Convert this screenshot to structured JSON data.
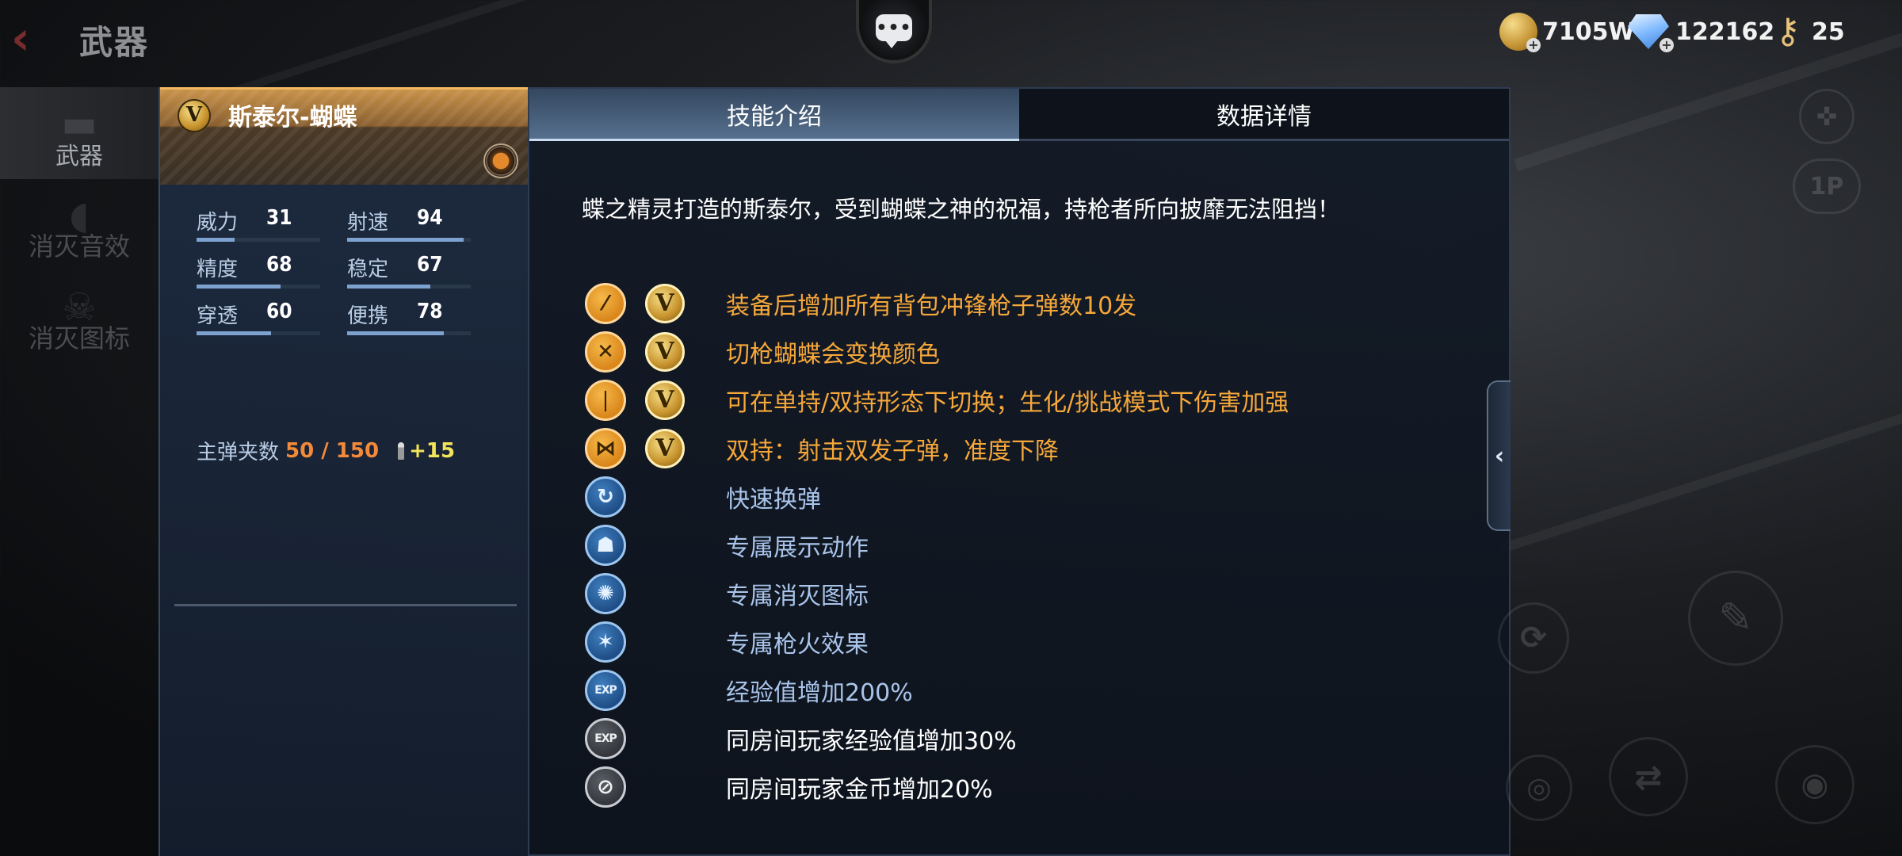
{
  "header": {
    "title": "武器",
    "back_icon": "back-arrow-icon",
    "chat_icon": "chat-icon"
  },
  "side_menu": [
    {
      "label": "武器",
      "icon": "rifle-icon",
      "active": true
    },
    {
      "label": "消灭音效",
      "icon": "speaker-icon",
      "active": false
    },
    {
      "label": "消灭图标",
      "icon": "skull-icon",
      "active": false
    }
  ],
  "currency": {
    "gold": "7105W",
    "diamond": "122162",
    "key": "25"
  },
  "weapon": {
    "badge": "V",
    "name": "斯泰尔-蝴蝶",
    "stats": [
      {
        "label": "威力",
        "value": "31",
        "level": 31
      },
      {
        "label": "射速",
        "value": "94",
        "level": 94
      },
      {
        "label": "精度",
        "value": "68",
        "level": 68
      },
      {
        "label": "稳定",
        "value": "67",
        "level": 67
      },
      {
        "label": "穿透",
        "value": "60",
        "level": 60
      },
      {
        "label": "便携",
        "value": "78",
        "level": 78
      }
    ],
    "ammo_label": "主弹夹数",
    "ammo_value": "50 / 150",
    "ammo_bonus": "+15"
  },
  "tabs": [
    {
      "label": "技能介绍",
      "active": true
    },
    {
      "label": "数据详情",
      "active": false
    }
  ],
  "description": "蝶之精灵打造的斯泰尔，受到蝴蝶之神的祝福，持枪者所向披靡无法阻挡！",
  "skills": [
    {
      "icon": "magazine-icon",
      "style": "gold",
      "v": true,
      "text": "装备后增加所有背包冲锋枪子弹数10发"
    },
    {
      "icon": "butterfly-swap-icon",
      "style": "gold",
      "v": true,
      "text": "切枪蝴蝶会变换颜色"
    },
    {
      "icon": "bullet-switch-icon",
      "style": "gold",
      "v": true,
      "text": "可在单持/双持形态下切换；生化/挑战模式下伤害加强"
    },
    {
      "icon": "dual-wield-icon",
      "style": "gold",
      "v": true,
      "text": "双持：射击双发子弹，准度下降"
    },
    {
      "icon": "fast-reload-icon",
      "style": "blue",
      "v": false,
      "text": "快速换弹"
    },
    {
      "icon": "showcase-icon",
      "style": "blue",
      "v": false,
      "text": "专属展示动作"
    },
    {
      "icon": "kill-icon",
      "style": "blue",
      "v": false,
      "text": "专属消灭图标"
    },
    {
      "icon": "muzzle-flash-icon",
      "style": "blue",
      "v": false,
      "text": "专属枪火效果"
    },
    {
      "icon": "exp-icon",
      "style": "blue",
      "v": false,
      "text": "经验值增加200%"
    },
    {
      "icon": "team-exp-icon",
      "style": "gray",
      "v": false,
      "text": "同房间玩家经验值增加30%"
    },
    {
      "icon": "team-gold-icon",
      "style": "gray",
      "v": false,
      "text": "同房间玩家金币增加20%"
    }
  ],
  "right_controls": {
    "view_toggle": "1P"
  }
}
